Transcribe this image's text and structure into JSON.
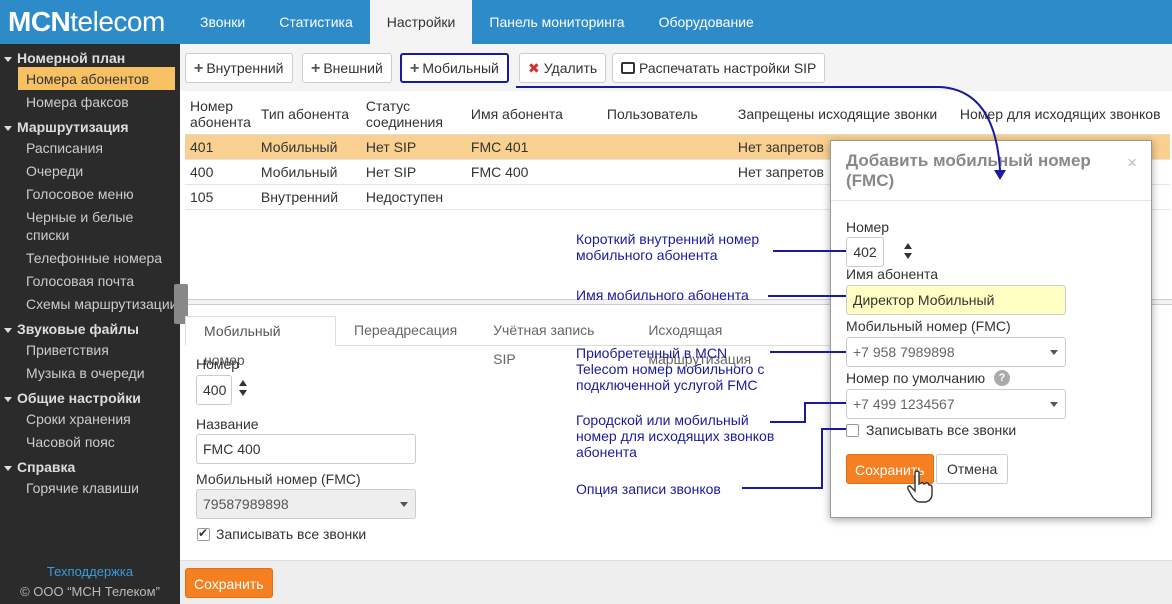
{
  "logo": {
    "bold": "MCN",
    "rest": "telecom"
  },
  "topnav": [
    "Звонки",
    "Статистика",
    "Настройки",
    "Панель мониторинга",
    "Оборудование"
  ],
  "sidebar": {
    "sections": [
      {
        "title": "Номерной план",
        "items": [
          "Номера абонентов",
          "Номера факсов"
        ]
      },
      {
        "title": "Маршрутизация",
        "items": [
          "Расписания",
          "Очереди",
          "Голосовое меню",
          "Черные и белые списки",
          "Телефонные номера",
          "Голосовая почта",
          "Схемы маршрутизации"
        ]
      },
      {
        "title": "Звуковые файлы",
        "items": [
          "Приветствия",
          "Музыка в очереди"
        ]
      },
      {
        "title": "Общие настройки",
        "items": [
          "Сроки хранения",
          "Часовой пояс"
        ]
      },
      {
        "title": "Справка",
        "items": [
          "Горячие клавиши"
        ]
      }
    ],
    "support": "Техподдержка",
    "copyright": "© ООО “МСН Телеком”"
  },
  "toolbar": {
    "internal": "Внутренний",
    "external": "Внешний",
    "mobile": "Мобильный",
    "delete": "Удалить",
    "print": "Распечатать настройки SIP"
  },
  "table": {
    "headers": [
      "Номер абонента",
      "Тип абонента",
      "Статус соединения",
      "Имя абонента",
      "Пользователь",
      "Запрещены исходящие звонки",
      "Номер для исходящих звонков"
    ],
    "rows": [
      [
        "401",
        "Мобильный",
        "Нет SIP",
        "FMC 401",
        "",
        "Нет запретов",
        ""
      ],
      [
        "400",
        "Мобильный",
        "Нет SIP",
        "FMC 400",
        "",
        "Нет запретов",
        ""
      ],
      [
        "105",
        "Внутренний",
        "Недоступен",
        "",
        "",
        "",
        ""
      ]
    ]
  },
  "bottom_tabs": [
    "Мобильный номер",
    "Переадресация",
    "Учётная запись SIP",
    "Исходящая маршрутизация"
  ],
  "form": {
    "number_label": "Номер",
    "number_value": "400",
    "name_label": "Название",
    "name_value": "FMC 400",
    "mobile_label": "Мобильный номер (FMC)",
    "mobile_value": "79587989898",
    "record_label": "Записывать все звонки"
  },
  "save_button": "Сохранить",
  "modal": {
    "title": "Добавить мобильный номер (FMC)",
    "close": "×",
    "number_label": "Номер",
    "number_value": "402",
    "name_label": "Имя абонента",
    "name_value": "Директор Мобильный",
    "mobile_label": "Мобильный номер (FMC)",
    "mobile_value": "+7 958 7989898",
    "default_label": "Номер по умолчанию",
    "default_value": "+7 499 1234567",
    "help": "?",
    "record_label": "Записывать все звонки",
    "save": "Сохранить",
    "cancel": "Отмена"
  },
  "annotations": {
    "short": "Короткий внутренний номер мобильного абонента",
    "name": "Имя мобильного абонента",
    "bought": "Приобретенный в MCN Telecom номер мобильного с подключенной услугой FMC",
    "outgoing": "Городской или мобильный номер для исходящих звонков абонента",
    "record": "Опция записи звонков"
  },
  "colors": {
    "nav": "#2d8bc9",
    "sidebar": "#2b2b2b",
    "accent": "#f48021",
    "selected_row": "#f9d08f",
    "annotation": "#1a1a9e",
    "highlight_input": "#ffffc4"
  }
}
